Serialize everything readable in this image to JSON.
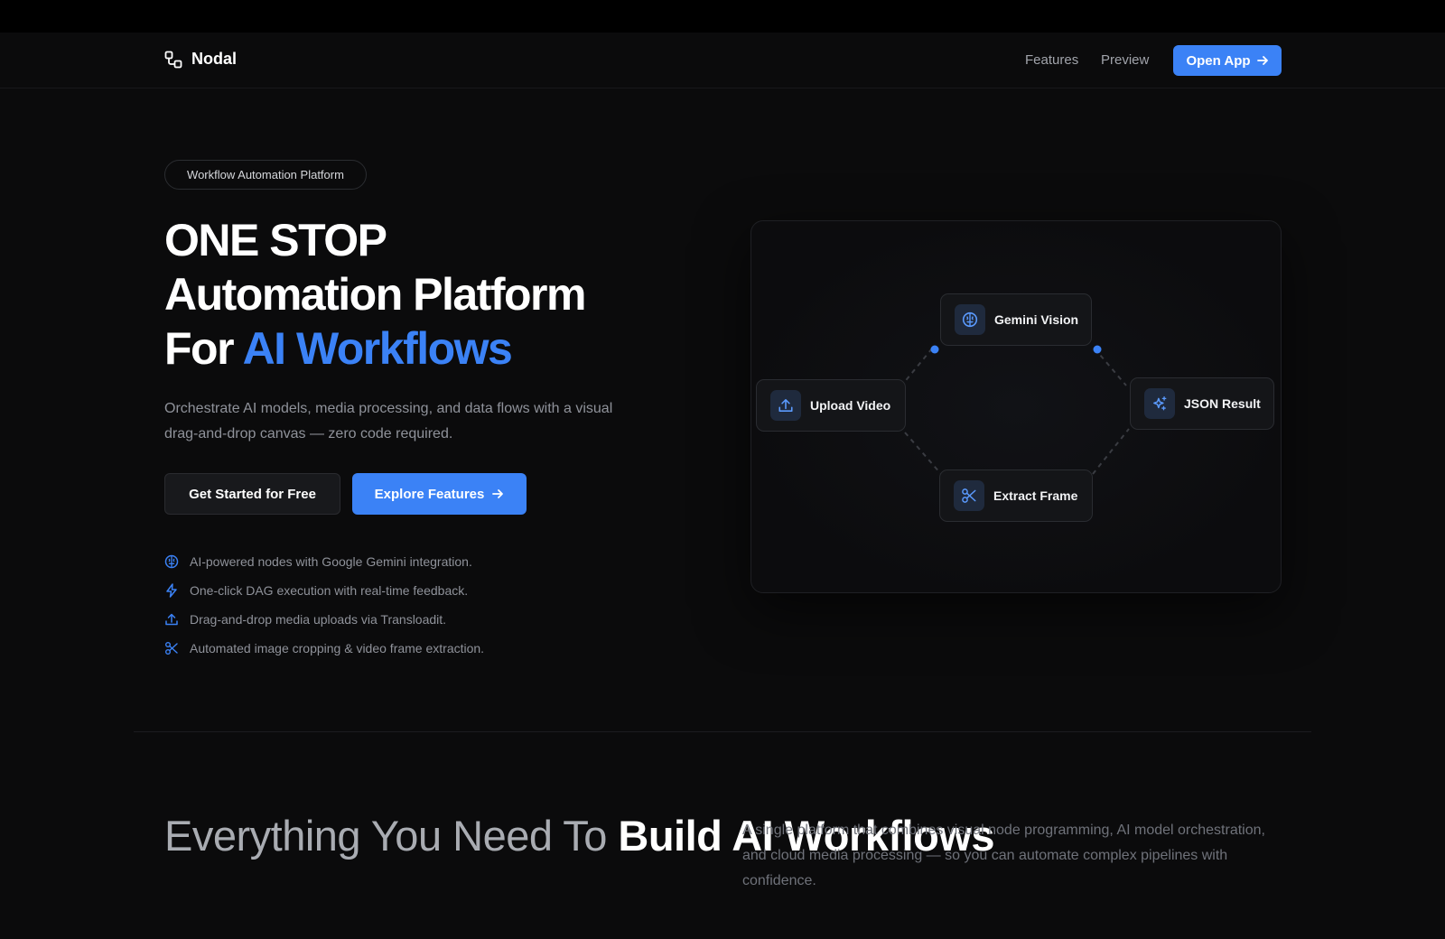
{
  "brand": {
    "name": "Nodal"
  },
  "nav": {
    "features": "Features",
    "preview": "Preview",
    "open_app": "Open App"
  },
  "hero": {
    "badge": "Workflow Automation Platform",
    "title_line1": "ONE STOP",
    "title_line2": "Automation Platform",
    "title_line3_prefix": "For ",
    "title_line3_accent": "AI Workflows",
    "description": "Orchestrate AI models, media processing, and data flows with a visual drag-and-drop canvas — zero code required.",
    "cta_primary": "Get Started for Free",
    "cta_secondary": "Explore Features",
    "features": [
      {
        "icon": "brain-icon",
        "text": "AI-powered nodes with Google Gemini integration."
      },
      {
        "icon": "bolt-icon",
        "text": "One-click DAG execution with real-time feedback."
      },
      {
        "icon": "upload-icon",
        "text": "Drag-and-drop media uploads via Transloadit."
      },
      {
        "icon": "scissors-icon",
        "text": "Automated image cropping & video frame extraction."
      }
    ]
  },
  "canvas": {
    "nodes": [
      {
        "icon": "brain-icon",
        "label": "Gemini Vision"
      },
      {
        "icon": "upload-icon",
        "label": "Upload Video"
      },
      {
        "icon": "sparkles-icon",
        "label": "JSON Result"
      },
      {
        "icon": "scissors-icon",
        "label": "Extract Frame"
      }
    ]
  },
  "section": {
    "title_light": "Everything You Need To ",
    "title_bold": "Build AI Workflows",
    "description": "A single platform that combines visual node programming, AI model orchestration, and cloud media processing — so you can automate complex pipelines with confidence."
  },
  "colors": {
    "accent": "#3b82f6",
    "background": "#0b0b0c"
  }
}
